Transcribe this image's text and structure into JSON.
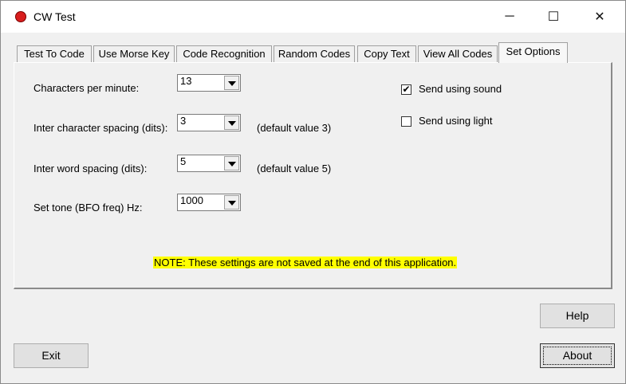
{
  "window": {
    "title": "CW Test",
    "minimize": "─",
    "maximize": "☐",
    "close": "✕"
  },
  "tabs": [
    {
      "label": "Test To Code"
    },
    {
      "label": "Use Morse Key"
    },
    {
      "label": "Code Recognition"
    },
    {
      "label": "Random Codes"
    },
    {
      "label": "Copy Text"
    },
    {
      "label": "View All Codes"
    },
    {
      "label": "Set Options",
      "active": true
    }
  ],
  "options": {
    "cpm_label": "Characters per minute:",
    "cpm_value": "13",
    "char_spacing_label": "Inter character spacing (dits):",
    "char_spacing_value": "3",
    "char_spacing_hint": "(default value 3)",
    "word_spacing_label": "Inter word spacing (dits):",
    "word_spacing_value": "5",
    "word_spacing_hint": "(default value 5)",
    "tone_label": "Set tone (BFO freq)  Hz:",
    "tone_value": "1000",
    "sound_label": "Send using sound",
    "sound_checked": true,
    "sound_mark": "✔",
    "light_label": "Send using light",
    "light_checked": false,
    "note": "NOTE: These settings are not saved at the end of this application."
  },
  "buttons": {
    "help": "Help",
    "exit": "Exit",
    "about": "About"
  },
  "colors": {
    "note_bg": "#ffff00",
    "app_icon": "#d81e1e"
  }
}
